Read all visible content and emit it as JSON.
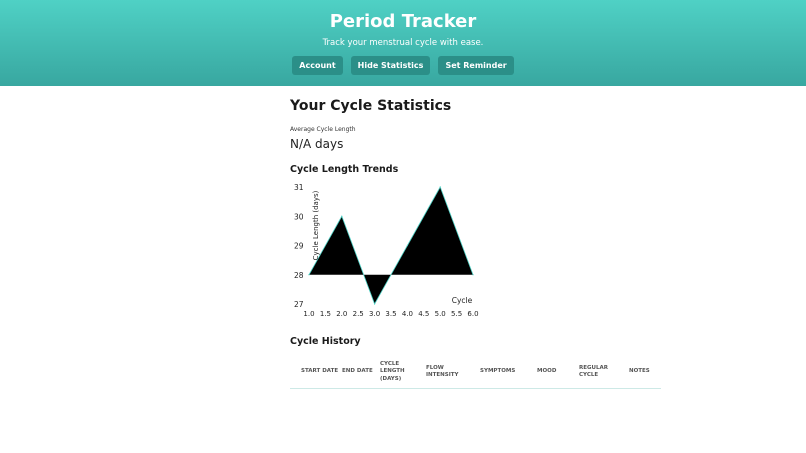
{
  "app": {
    "title": "Period Tracker",
    "subtitle": "Track your menstrual cycle with ease."
  },
  "nav": {
    "account_label": "Account",
    "hide_statistics_label": "Hide Statistics",
    "set_reminder_label": "Set Reminder"
  },
  "stats": {
    "title": "Your Cycle Statistics",
    "avg_label": "Average Cycle Length",
    "avg_value": "N/A days",
    "trends_title": "Cycle Length Trends"
  },
  "chart_data": {
    "type": "area",
    "title": "Cycle Length Trends",
    "xlabel": "Cycle",
    "ylabel": "Cycle Length (days)",
    "x": [
      1,
      2,
      3,
      4,
      5,
      6
    ],
    "series": [
      {
        "values": [
          28,
          30,
          27,
          29,
          31,
          28
        ]
      }
    ],
    "baseline": 28,
    "xlim": [
      1.0,
      6.0
    ],
    "ylim": [
      27,
      31
    ],
    "x_ticks": [
      "1.0",
      "1.5",
      "2.0",
      "2.5",
      "3.0",
      "3.5",
      "4.0",
      "4.5",
      "5.0",
      "5.5",
      "6.0"
    ],
    "y_ticks": [
      "27",
      "28",
      "29",
      "30",
      "31"
    ],
    "grid": false,
    "fill_color": "#000000",
    "stroke_color": "#4fd1c5"
  },
  "history": {
    "title": "Cycle History",
    "columns": [
      "Start Date",
      "End Date",
      "Cycle Length (Days)",
      "Flow Intensity",
      "Symptoms",
      "Mood",
      "Regular Cycle",
      "Notes"
    ],
    "rows": []
  },
  "colors": {
    "header_gradient_start": "#4fd1c5",
    "header_gradient_end": "#38a7a0",
    "nav_button": "#2b8f88"
  }
}
